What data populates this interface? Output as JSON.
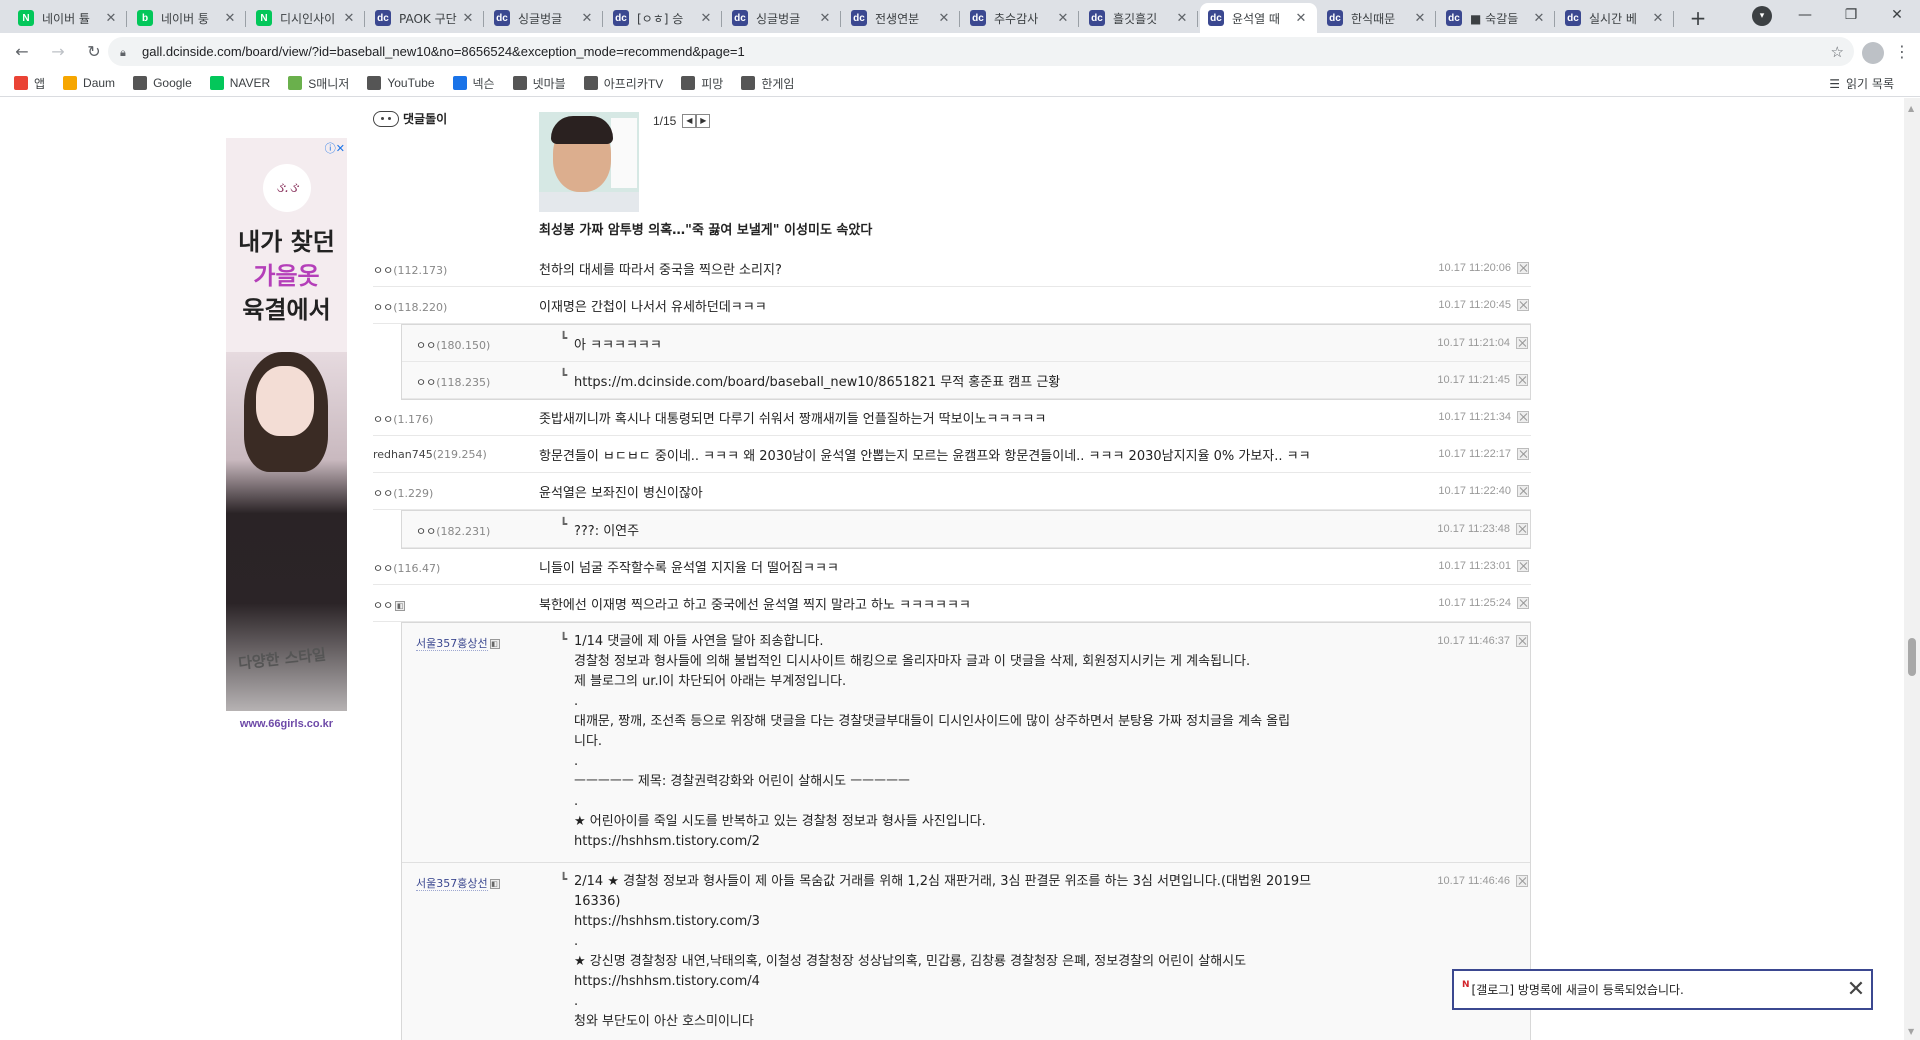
{
  "browser": {
    "tabs": [
      {
        "label": "네이버 튤",
        "icon": "naver-icon",
        "color": "#03c75a",
        "glyph": "N"
      },
      {
        "label": "네이버 퉁",
        "icon": "band-icon",
        "color": "#03c75a",
        "glyph": "b"
      },
      {
        "label": "디시인사이",
        "icon": "naver-icon",
        "color": "#03c75a",
        "glyph": "N"
      },
      {
        "label": "PAOK 구단",
        "icon": "dc-icon",
        "color": "#3b4890",
        "glyph": "dc"
      },
      {
        "label": "싱글벙글",
        "icon": "dc-icon",
        "color": "#3b4890",
        "glyph": "dc"
      },
      {
        "label": "[ㅇㅎ] 승",
        "icon": "dc-icon",
        "color": "#3b4890",
        "glyph": "dc"
      },
      {
        "label": "싱글벙글",
        "icon": "dc-icon",
        "color": "#3b4890",
        "glyph": "dc"
      },
      {
        "label": "전생연분",
        "icon": "dc-icon",
        "color": "#3b4890",
        "glyph": "dc"
      },
      {
        "label": "추수감사",
        "icon": "dc-icon",
        "color": "#3b4890",
        "glyph": "dc"
      },
      {
        "label": "흘깃흘깃",
        "icon": "dc-icon",
        "color": "#3b4890",
        "glyph": "dc"
      },
      {
        "label": "윤석열 때",
        "icon": "dc-icon",
        "color": "#3b4890",
        "glyph": "dc",
        "active": true
      },
      {
        "label": "한식때문",
        "icon": "dc-icon",
        "color": "#3b4890",
        "glyph": "dc"
      },
      {
        "label": "■ 숙갈들",
        "icon": "dc-icon",
        "color": "#3b4890",
        "glyph": "dc"
      },
      {
        "label": "실시간 베",
        "icon": "dc-icon",
        "color": "#3b4890",
        "glyph": "dc"
      }
    ],
    "url": "gall.dcinside.com/board/view/?id=baseball_new10&no=8656524&exception_mode=recommend&page=1",
    "bookmarks": [
      {
        "label": "앱",
        "color": "#ea4335"
      },
      {
        "label": "Daum",
        "color": "#f6a600"
      },
      {
        "label": "Google",
        "color": "#555555"
      },
      {
        "label": "NAVER",
        "color": "#03c75a"
      },
      {
        "label": "S매니저",
        "color": "#6ab04c"
      },
      {
        "label": "YouTube",
        "color": "#555555"
      },
      {
        "label": "넥슨",
        "color": "#1a73e8"
      },
      {
        "label": "넷마블",
        "color": "#555555"
      },
      {
        "label": "아프리카TV",
        "color": "#555555"
      },
      {
        "label": "피망",
        "color": "#555555"
      },
      {
        "label": "한게임",
        "color": "#555555"
      }
    ],
    "reading_list": "읽기 목록"
  },
  "ad": {
    "logo": "ઙ.ઙ",
    "line1": "내가 찾던",
    "line2": "가을옷",
    "line3": "육결에서",
    "tagline": "다양한 스타일",
    "url": "www.66girls.co.kr"
  },
  "bot": {
    "name": "댓글돌이",
    "page": "1/15",
    "news_title": "최성봉 가짜 암투병 의혹…\"죽 끓여 보낼게\" 이성미도 속았다"
  },
  "comments": [
    {
      "nick": "ㅇㅇ",
      "ip": "(112.173)",
      "text": "천하의 대세를 따라서 중국을 찍으란 소리지?",
      "ts": "10.17 11:20:06"
    },
    {
      "nick": "ㅇㅇ",
      "ip": "(118.220)",
      "text": "이재명은 간첩이 나서서 유세하던데ㅋㅋㅋ",
      "ts": "10.17 11:20:45"
    },
    {
      "nick": "ㅇㅇ",
      "ip": "(180.150)",
      "text": "아 ㅋㅋㅋㅋㅋㅋ",
      "ts": "10.17 11:21:04"
    },
    {
      "nick": "ㅇㅇ",
      "ip": "(118.235)",
      "text": "https://m.dcinside.com/board/baseball_new10/8651821 무적 홍준표 캠프 근황",
      "ts": "10.17 11:21:45"
    },
    {
      "nick": "ㅇㅇ",
      "ip": "(1.176)",
      "text": "좃밥새끼니까 혹시나 대통령되면 다루기 쉬워서 짱깨새끼들 언플질하는거 딱보이노ㅋㅋㅋㅋㅋ",
      "ts": "10.17 11:21:34"
    },
    {
      "nick": "redhan745",
      "ip": "(219.254)",
      "text": "항문견들이 ㅂㄷㅂㄷ 중이네.. ㅋㅋㅋ 왜 2030남이 윤석열 안뽑는지 모르는 윤캠프와 항문견들이네.. ㅋㅋㅋ 2030남지지율 0% 가보자.. ㅋㅋ",
      "ts": "10.17 11:22:17"
    },
    {
      "nick": "ㅇㅇ",
      "ip": "(1.229)",
      "text": "윤석열은 보좌진이 병신이잖아",
      "ts": "10.17 11:22:40"
    },
    {
      "nick": "ㅇㅇ",
      "ip": "(182.231)",
      "text": "???: 이연주",
      "ts": "10.17 11:23:48"
    },
    {
      "nick": "ㅇㅇ",
      "ip": "(116.47)",
      "text": "니들이 넘굴 주작할수록 윤석열 지지율 더 떨어짐ㅋㅋㅋ",
      "ts": "10.17 11:23:01"
    },
    {
      "nick": "ㅇㅇ",
      "ip": "",
      "text": "북한에선 이재명 찍으라고 하고 중국에선 윤석열 찍지 말라고 하노 ㅋㅋㅋㅋㅋㅋ",
      "ts": "10.17 11:25:24"
    },
    {
      "nick": "서울357홍상선",
      "ip": "",
      "text": "1/14 댓글에 제 아들 사연을 달아 죄송합니다.\n경찰청 정보과 형사들에 의해 불법적인 디시사이트 해킹으로 올리자마자 글과 이 댓글을 삭제, 회원정지시키는 게 계속됩니다.\n제 블로그의 ur.l이 차단되어 아래는 부계정입니다.\n.\n대깨문, 짱깨, 조선족 등으로 위장해 댓글을 다는 경찰댓글부대들이 디시인사이드에 많이 상주하면서 분탕용 가짜 정치글을 계속 올립\n니다.\n.\nㅡㅡㅡㅡㅡ 제목: 경찰권력강화와 어린이 살해시도 ㅡㅡㅡㅡㅡ\n.\n★ 어린아이를 죽일 시도를 반복하고 있는 경찰청 정보과 형사들 사진입니다.\nhttps://hshhsm.tistory.com/2",
      "ts": "10.17 11:46:37"
    },
    {
      "nick": "서울357홍상선",
      "ip": "",
      "text": "2/14 ★ 경찰청 정보과 형사들이 제 아들 목숨값 거래를 위해 1,2심 재판거래, 3심 판결문 위조를 하는 3심 서면입니다.(대법원 2019므\n16336)\nhttps://hshhsm.tistory.com/3\n.\n★ 강신명 경찰청장 내연,낙태의혹, 이철성 경찰청장 성상납의혹, 민갑룡, 김창룡 경찰청장 은폐, 정보경찰의 어린이 살해시도\nhttps://hshhsm.tistory.com/4\n.\n청와 부단도이 아산 호스미이니다",
      "ts": "10.17 11:46:46"
    }
  ],
  "toast": {
    "text": "[갤로그] 방명록에 새글이 등록되었습니다."
  }
}
